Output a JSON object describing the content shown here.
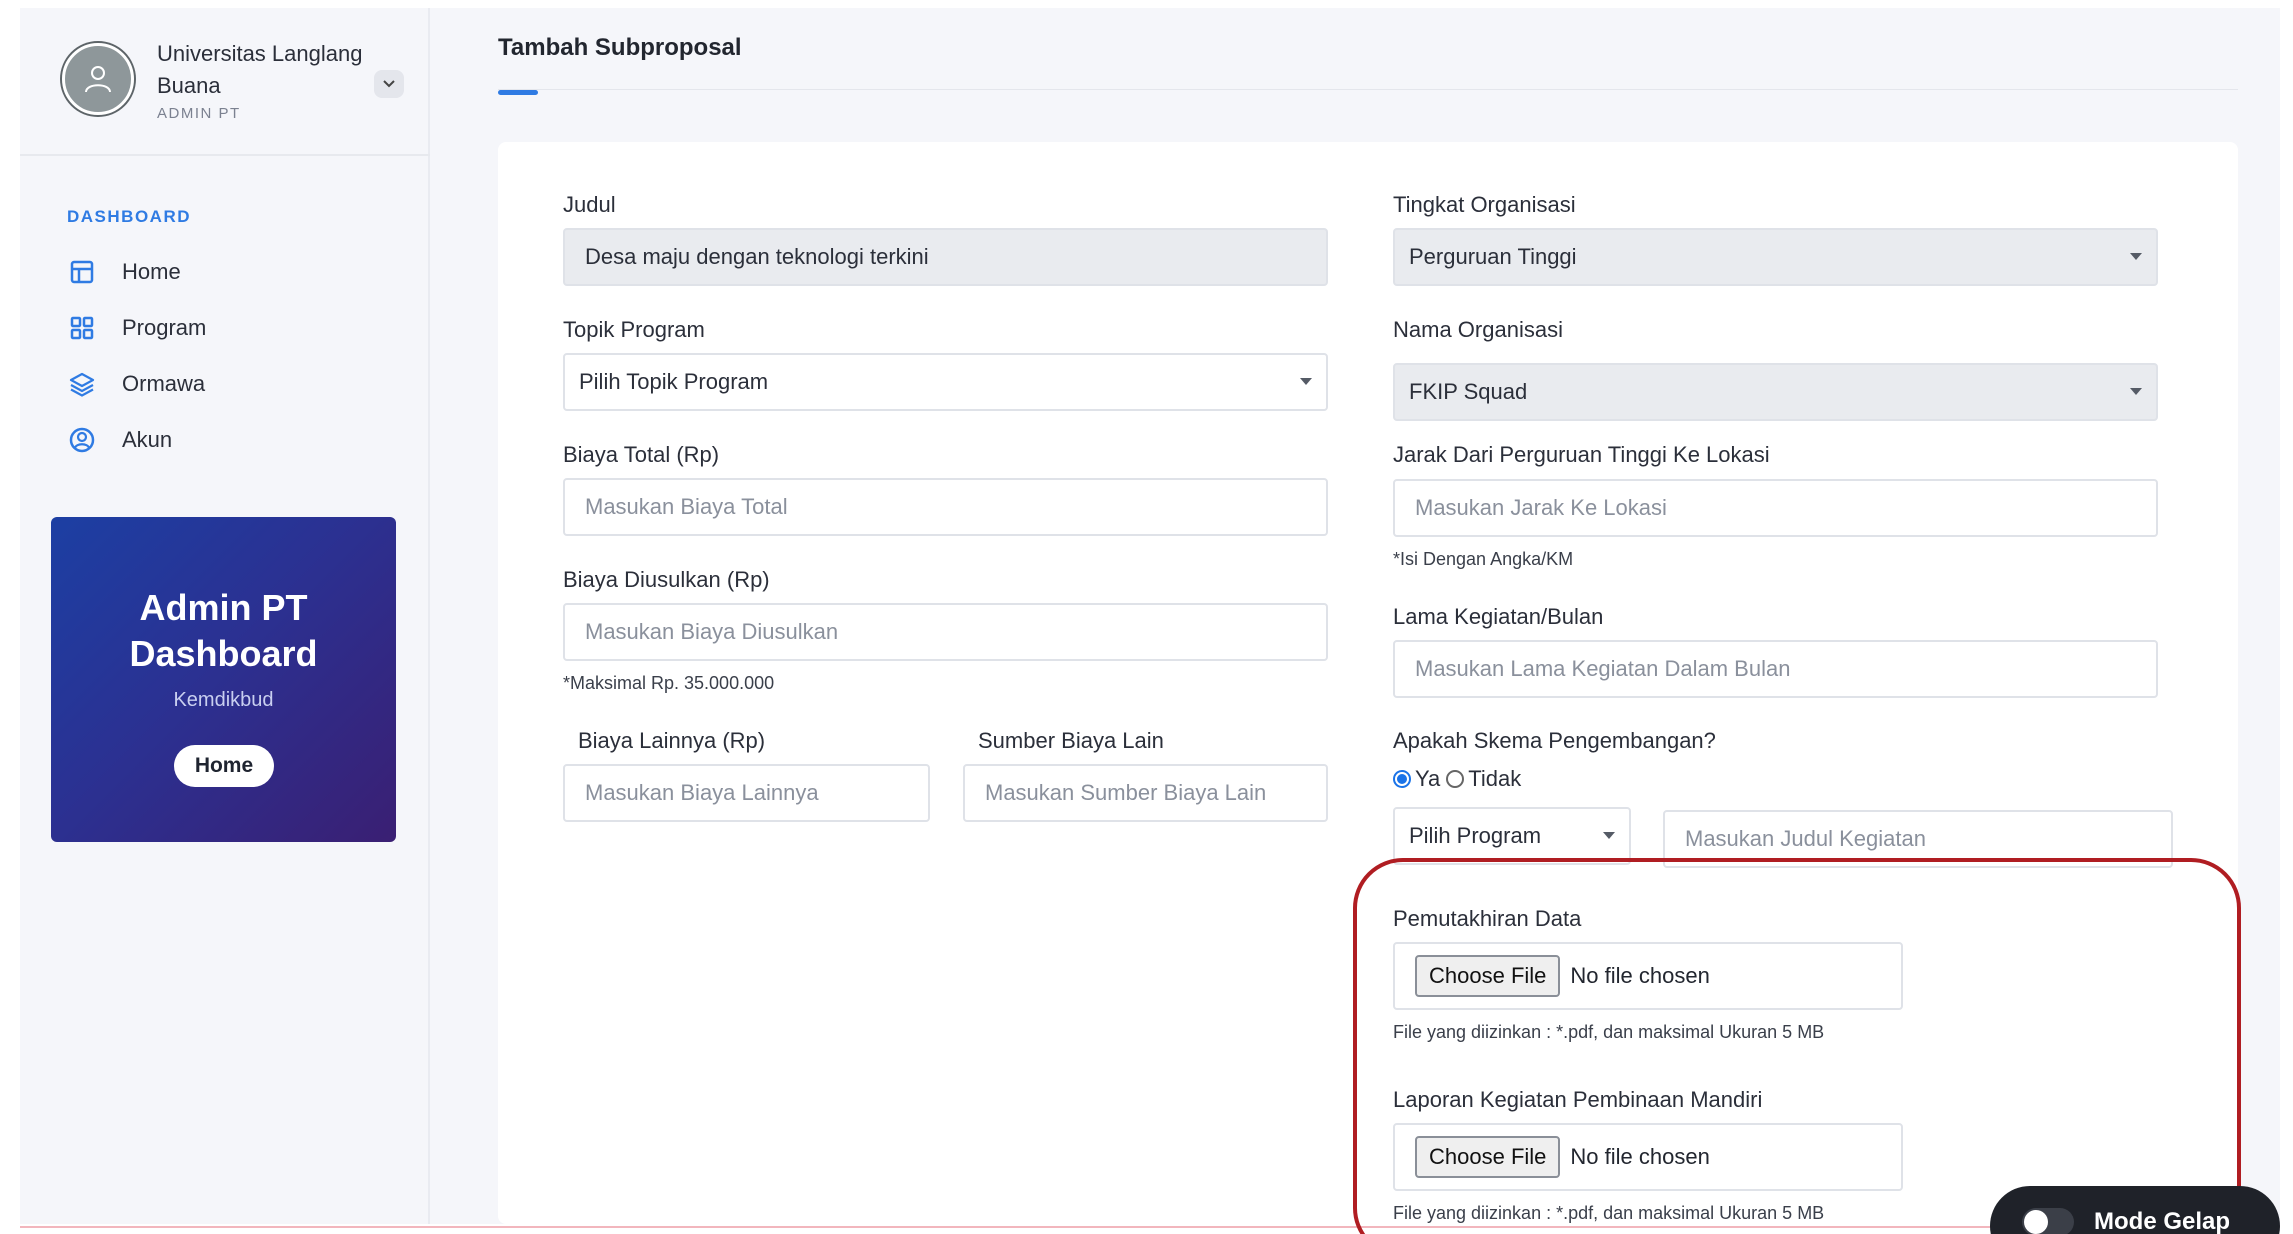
{
  "sidebar": {
    "profile": {
      "name": "Universitas Langlang Buana",
      "role": "ADMIN PT"
    },
    "section_label": "DASHBOARD",
    "items": [
      {
        "label": "Home",
        "icon": "layout-icon"
      },
      {
        "label": "Program",
        "icon": "grid-icon"
      },
      {
        "label": "Ormawa",
        "icon": "layers-icon"
      },
      {
        "label": "Akun",
        "icon": "user-circle-icon"
      }
    ],
    "promo": {
      "title_line1": "Admin PT",
      "title_line2": "Dashboard",
      "subtitle": "Kemdikbud",
      "button": "Home"
    }
  },
  "header": {
    "tab_title": "Tambah Subproposal"
  },
  "form": {
    "judul": {
      "label": "Judul",
      "value": "Desa maju dengan teknologi terkini"
    },
    "topik": {
      "label": "Topik Program",
      "value": "Pilih Topik Program"
    },
    "biaya_total": {
      "label": "Biaya Total (Rp)",
      "placeholder": "Masukan Biaya Total"
    },
    "biaya_diusulkan": {
      "label": "Biaya Diusulkan (Rp)",
      "placeholder": "Masukan Biaya Diusulkan",
      "hint": "*Maksimal Rp. 35.000.000"
    },
    "biaya_lainnya": {
      "label": "Biaya Lainnya (Rp)",
      "placeholder": "Masukan Biaya Lainnya"
    },
    "sumber_biaya": {
      "label": "Sumber Biaya Lain",
      "placeholder": "Masukan Sumber Biaya Lain"
    },
    "tingkat": {
      "label": "Tingkat Organisasi",
      "value": "Perguruan Tinggi"
    },
    "nama_org": {
      "label": "Nama Organisasi",
      "value": "FKIP Squad"
    },
    "jarak": {
      "label": "Jarak Dari Perguruan Tinggi Ke Lokasi",
      "placeholder": "Masukan Jarak Ke Lokasi",
      "hint": "*Isi Dengan Angka/KM"
    },
    "lama": {
      "label": "Lama Kegiatan/Bulan",
      "placeholder": "Masukan Lama Kegiatan Dalam Bulan"
    },
    "skema": {
      "label": "Apakah Skema Pengembangan?",
      "option_yes": "Ya",
      "option_no": "Tidak",
      "selected": "Ya",
      "program_select": "Pilih Program",
      "judul_placeholder": "Masukan Judul Kegiatan"
    },
    "pemutakhiran": {
      "label": "Pemutakhiran Data",
      "button": "Choose File",
      "status": "No file chosen",
      "hint": "File yang diizinkan : *.pdf, dan maksimal Ukuran 5 MB"
    },
    "laporan": {
      "label": "Laporan Kegiatan Pembinaan Mandiri",
      "button": "Choose File",
      "status": "No file chosen",
      "hint": "File yang diizinkan : *.pdf, dan maksimal Ukuran 5 MB"
    }
  },
  "dark_mode": {
    "label": "Mode Gelap",
    "enabled": false
  },
  "colors": {
    "accent": "#2f7be3",
    "highlight": "#b01d22",
    "promo_start": "#1c3fa3",
    "promo_end": "#3a1f73"
  }
}
